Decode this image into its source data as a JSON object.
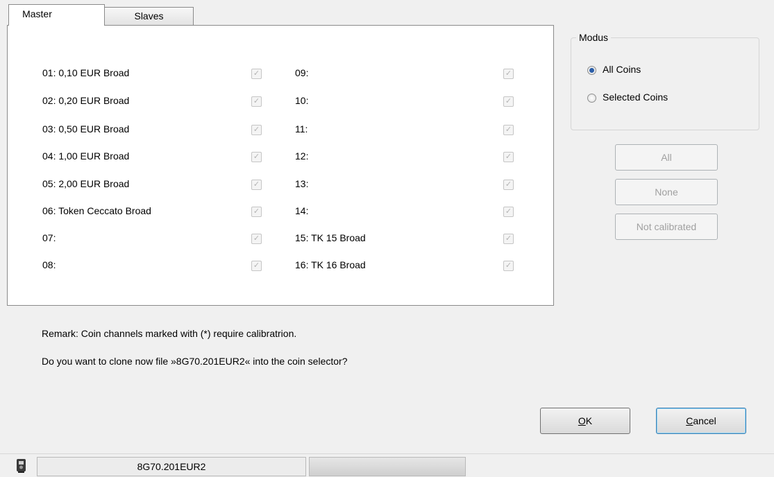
{
  "tabs": [
    {
      "label": "Master",
      "active": true
    },
    {
      "label": "Slaves",
      "active": false
    }
  ],
  "coins_left": [
    {
      "label": "01: 0,10 EUR Broad",
      "checked": true
    },
    {
      "label": "02: 0,20 EUR Broad",
      "checked": true
    },
    {
      "label": "03: 0,50 EUR Broad",
      "checked": true
    },
    {
      "label": "04: 1,00 EUR Broad",
      "checked": true
    },
    {
      "label": "05: 2,00 EUR Broad",
      "checked": true
    },
    {
      "label": "06: Token Ceccato Broad",
      "checked": true
    },
    {
      "label": "07:",
      "checked": true
    },
    {
      "label": "08:",
      "checked": true
    }
  ],
  "coins_right": [
    {
      "label": "09:",
      "checked": true
    },
    {
      "label": "10:",
      "checked": true
    },
    {
      "label": "11:",
      "checked": true
    },
    {
      "label": "12:",
      "checked": true
    },
    {
      "label": "13:",
      "checked": true
    },
    {
      "label": "14:",
      "checked": true
    },
    {
      "label": "15: TK 15 Broad",
      "checked": true
    },
    {
      "label": "16: TK 16 Broad",
      "checked": true
    }
  ],
  "modus": {
    "title": "Modus",
    "options": [
      {
        "label": "All Coins",
        "checked": true
      },
      {
        "label": "Selected Coins",
        "checked": false
      }
    ]
  },
  "selection_buttons": {
    "all": "All",
    "none": "None",
    "not_calibrated": "Not calibrated"
  },
  "remark": "Remark: Coin channels marked with (*) require calibratrion.",
  "question": "Do you want to clone now file »8G70.201EUR2« into the coin selector?",
  "dialog_buttons": {
    "ok_mnemonic": "O",
    "ok_rest": "K",
    "cancel_mnemonic": "C",
    "cancel_rest": "ancel"
  },
  "status": {
    "device_icon": "coin-selector-icon",
    "file": "8G70.201EUR2"
  },
  "colors": {
    "radio_selected": "#2b5ea8",
    "disabled_text": "#a0a0a0",
    "default_button_border": "#3c7fb1"
  }
}
